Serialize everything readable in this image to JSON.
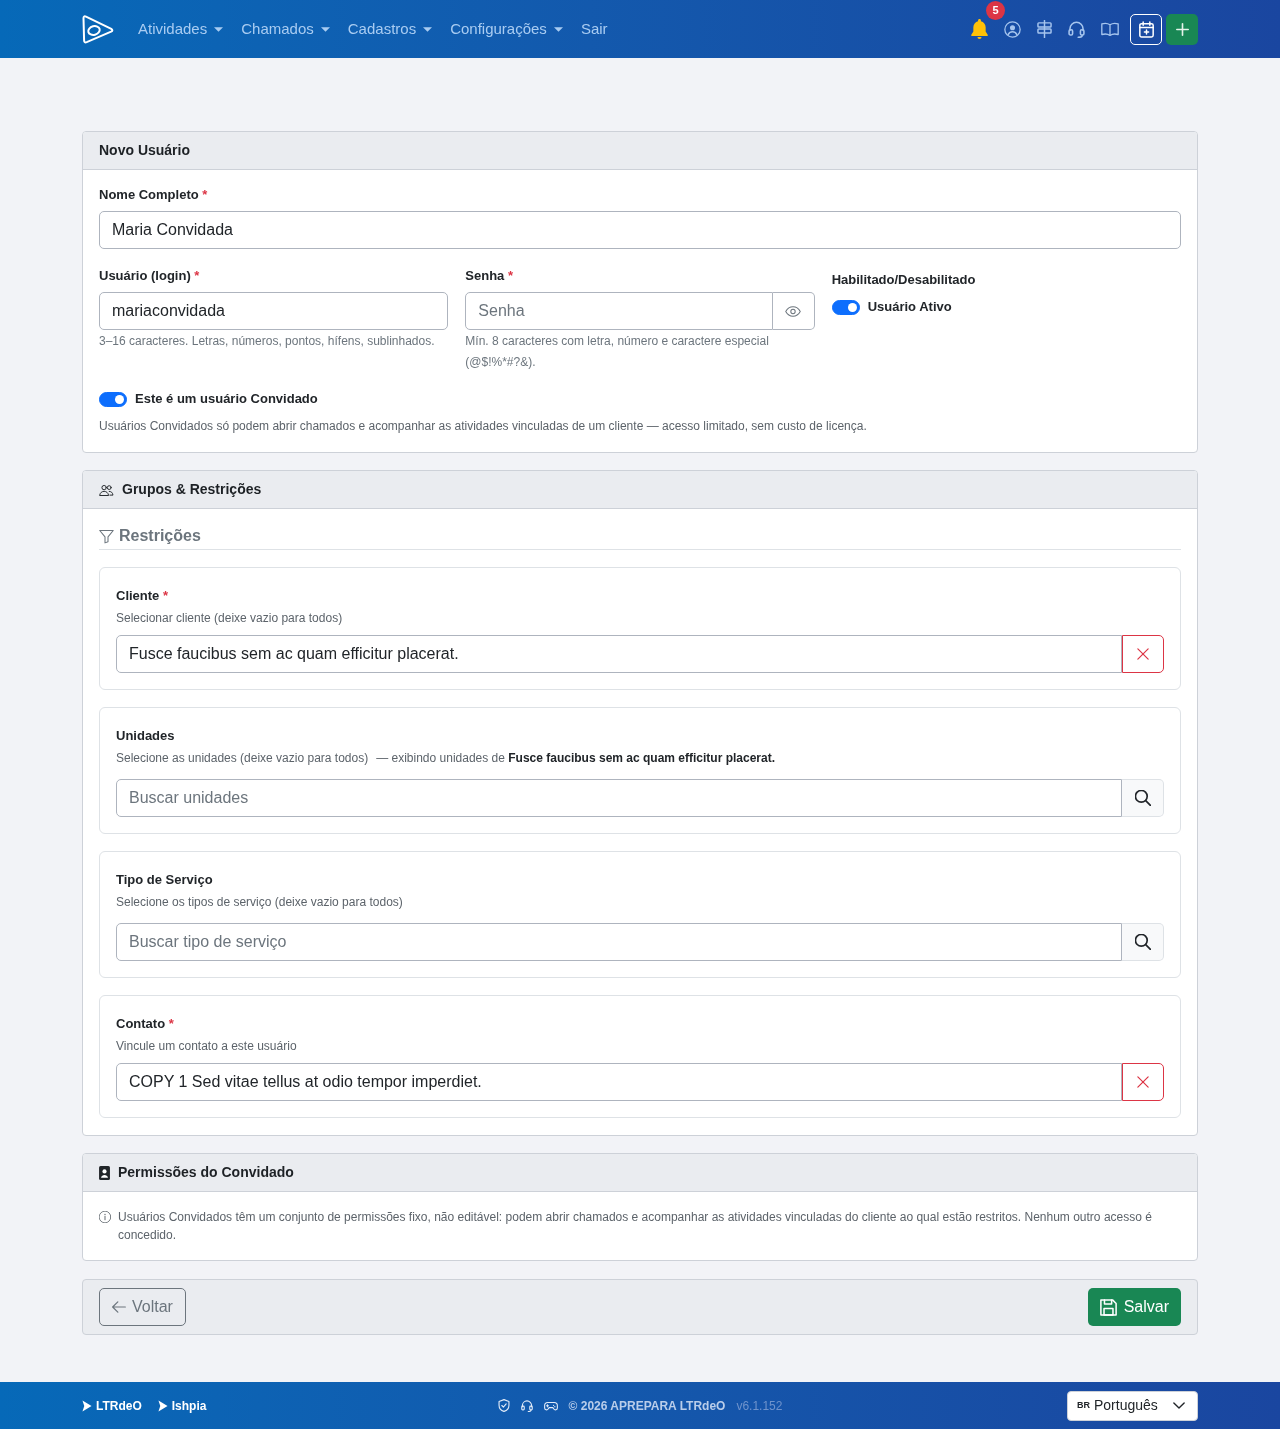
{
  "navbar": {
    "menu": [
      {
        "label": "Atividades",
        "dropdown": true
      },
      {
        "label": "Chamados",
        "dropdown": true
      },
      {
        "label": "Cadastros",
        "dropdown": true
      },
      {
        "label": "Configurações",
        "dropdown": true
      },
      {
        "label": "Sair",
        "dropdown": false
      }
    ],
    "notifications": {
      "count": "5"
    }
  },
  "user_card": {
    "title": "Novo Usuário",
    "full_name": {
      "label": "Nome Completo",
      "required_mark": "*",
      "value": "Maria Convidada"
    },
    "login": {
      "label": "Usuário (login)",
      "required_mark": "*",
      "value": "mariaconvidada",
      "help": "3–16 caracteres. Letras, números, pontos, hífens, sublinhados."
    },
    "password": {
      "label": "Senha",
      "required_mark": "*",
      "placeholder": "Senha",
      "help": "Mín. 8 caracteres com letra, número e caractere especial (@$!%*#?&)."
    },
    "status": {
      "label": "Habilitado/Desabilitado",
      "toggle_label": "Usuário Ativo",
      "on": true
    },
    "guest": {
      "toggle_label": "Este é um usuário Convidado",
      "on": true,
      "description": "Usuários Convidados só podem abrir chamados e acompanhar as atividades vinculadas de um cliente — acesso limitado, sem custo de licença."
    }
  },
  "groups_card": {
    "title": "Grupos & Restrições",
    "section_title": "Restrições",
    "filters": [
      {
        "kind": "select",
        "label": "Cliente",
        "required_mark": "*",
        "hint": "Selecionar cliente (deixe vazio para todos)",
        "value": "Fusce faucibus sem ac quam efficitur placerat."
      },
      {
        "kind": "search",
        "label": "Unidades",
        "hint": "Selecione as unidades (deixe vazio para todos)",
        "context": "— exibindo unidades de **Fusce faucibus sem ac quam efficitur placerat.**",
        "placeholder": "Buscar unidades"
      },
      {
        "kind": "search",
        "label": "Tipo de Serviço",
        "hint": "Selecione os tipos de serviço (deixe vazio para todos)",
        "placeholder": "Buscar tipo de serviço"
      },
      {
        "kind": "select",
        "label": "Contato",
        "required_mark": "*",
        "hint": "Vincule um contato a este usuário",
        "value": "COPY 1 Sed vitae tellus at odio tempor imperdiet."
      }
    ]
  },
  "permissions_card": {
    "title": "Permissões do Convidado",
    "text": "Usuários Convidados têm um conjunto de permissões fixo, não editável: podem abrir chamados e acompanhar as atividades vinculadas do cliente ao qual estão restritos. Nenhum outro acesso é concedido."
  },
  "actions": {
    "back": "Voltar",
    "save": "Salvar"
  },
  "footer": {
    "links": [
      "LTRdeO",
      "Ishpia"
    ],
    "copyright": "© 2026 APREPARA LTRdeO",
    "version": "v6.1.152",
    "language": {
      "flag": "BR",
      "value": "Português"
    }
  }
}
